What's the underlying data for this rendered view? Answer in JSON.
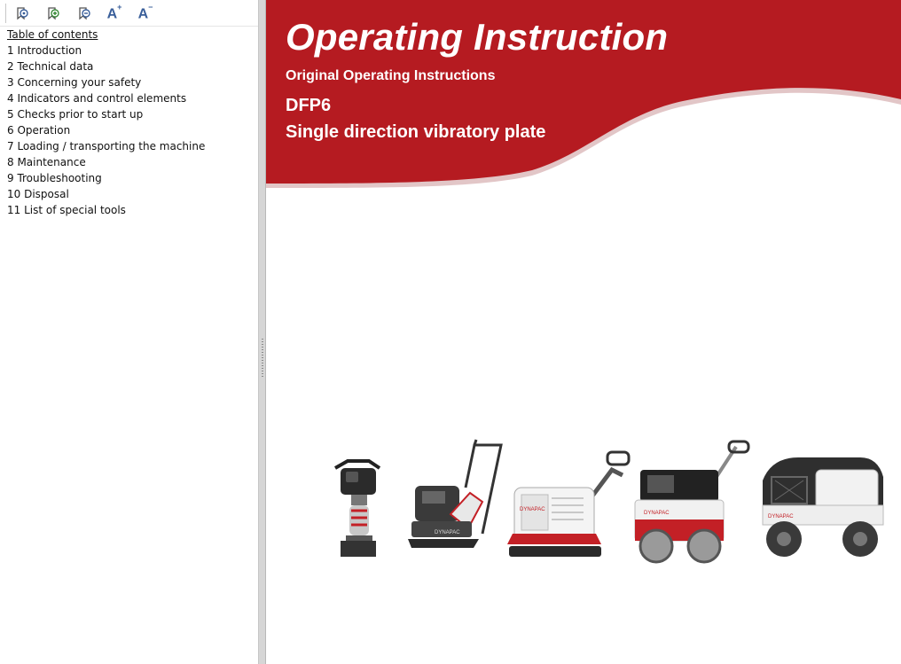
{
  "toolbar": {
    "buttons": [
      {
        "name": "bookmark-icon"
      },
      {
        "name": "bookmark-add-icon"
      },
      {
        "name": "bookmark-remove-icon"
      },
      {
        "name": "font-increase-icon",
        "label": "A",
        "sup": "+"
      },
      {
        "name": "font-decrease-icon",
        "label": "A",
        "sup": "−"
      }
    ]
  },
  "toc": {
    "title": "Table of contents",
    "items": [
      "1 Introduction",
      "2 Technical data",
      "3 Concerning your safety",
      "4 Indicators and control elements",
      "5 Checks prior to start up",
      "6 Operation",
      "7 Loading / transporting the machine",
      "8 Maintenance",
      "9 Troubleshooting",
      "10 Disposal",
      "11 List of special tools"
    ]
  },
  "document": {
    "title": "Operating Instruction",
    "subtitle": "Original Operating Instructions",
    "model": "DFP6",
    "product": "Single direction vibratory plate",
    "brand_label": "DYNAPAC"
  },
  "colors": {
    "banner_red": "#b51b21",
    "banner_shadow": "#e5c9ca",
    "toolbar_icon": "#3a5f9a"
  }
}
